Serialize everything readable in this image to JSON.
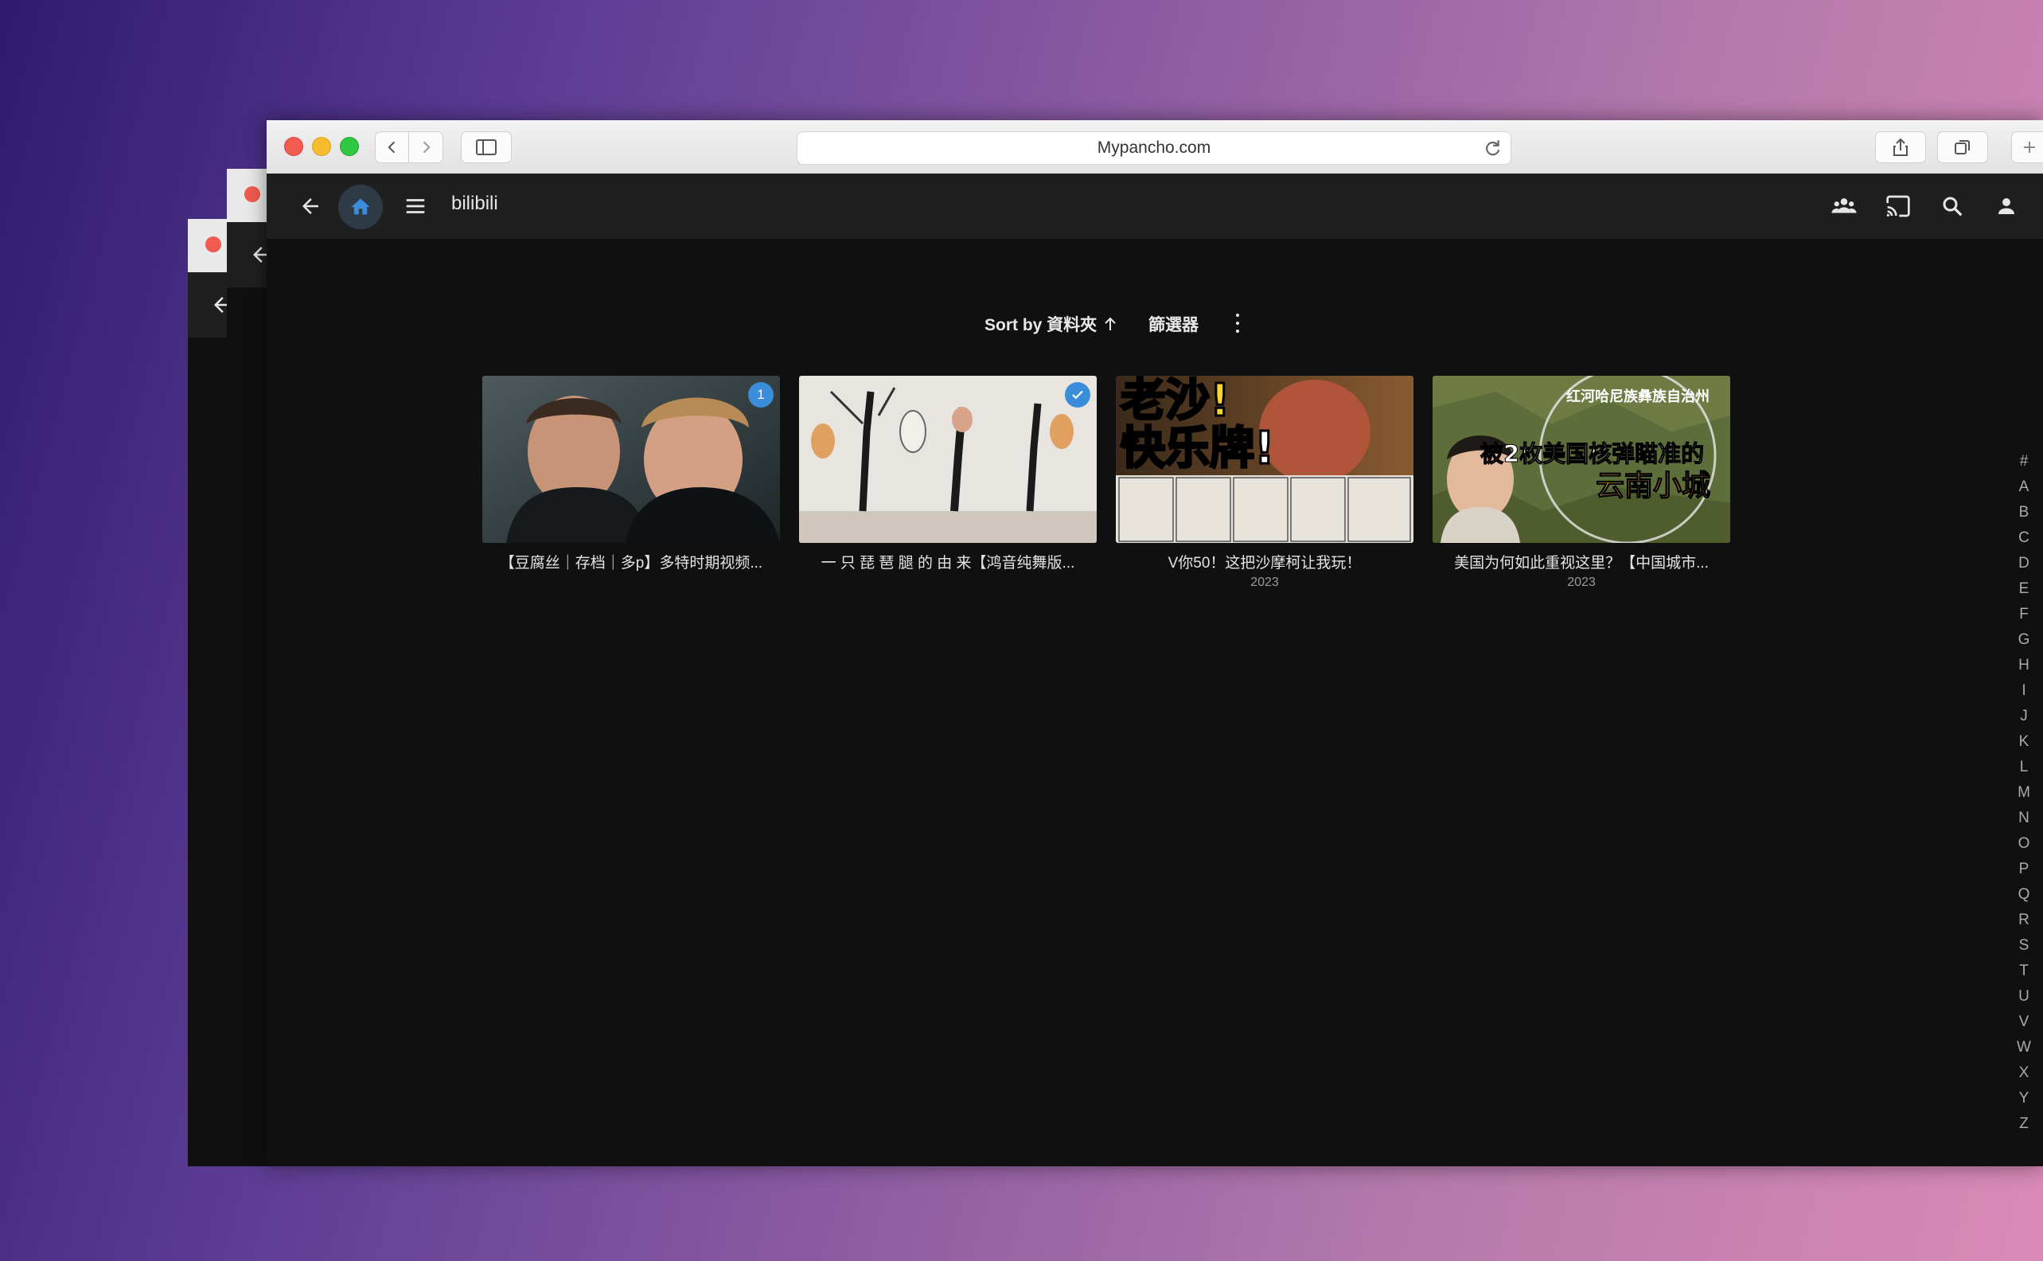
{
  "browser": {
    "url": "Mypancho.com"
  },
  "app": {
    "title": "bilibili"
  },
  "toolbar": {
    "sort_label": "Sort by 資料夾",
    "filter_label": "篩選器"
  },
  "items": [
    {
      "title": "【豆腐丝｜存档｜多p】多特时期视频...",
      "year": "",
      "badge": "1"
    },
    {
      "title": "一 只 琵 琶 腿 的 由 来【鸿音纯舞版...",
      "year": "",
      "badge": "played"
    },
    {
      "title": "V你50！这把沙摩柯让我玩！",
      "year": "2023",
      "thumb_text_1": "老沙!",
      "thumb_text_2": "快乐牌!"
    },
    {
      "title": "美国为何如此重视这里？【中国城市...",
      "year": "2023",
      "thumb_text_1": "被2枚美国核弹瞄准的",
      "thumb_text_2": "云南小城",
      "thumb_text_3": "红河哈尼族彝族自治州"
    }
  ],
  "alphabet": [
    "#",
    "A",
    "B",
    "C",
    "D",
    "E",
    "F",
    "G",
    "H",
    "I",
    "J",
    "K",
    "L",
    "M",
    "N",
    "O",
    "P",
    "Q",
    "R",
    "S",
    "T",
    "U",
    "V",
    "W",
    "X",
    "Y",
    "Z"
  ],
  "colors": {
    "accent": "#3a8ddb",
    "background": "#101010",
    "header": "#1f1f1f"
  }
}
